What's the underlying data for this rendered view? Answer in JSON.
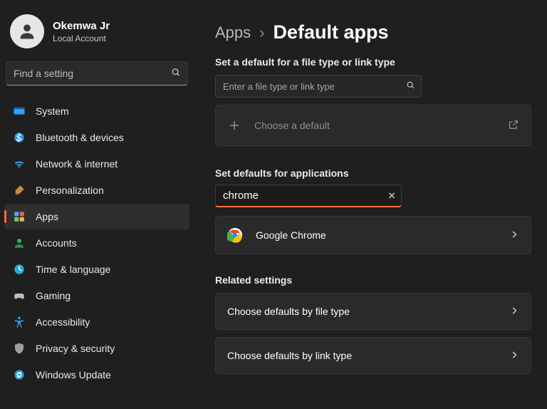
{
  "profile": {
    "name": "Okemwa Jr",
    "subtitle": "Local Account"
  },
  "sidebar_search_placeholder": "Find a setting",
  "nav": {
    "items": [
      {
        "id": "system",
        "label": "System"
      },
      {
        "id": "bluetooth",
        "label": "Bluetooth & devices"
      },
      {
        "id": "network",
        "label": "Network & internet"
      },
      {
        "id": "personalization",
        "label": "Personalization"
      },
      {
        "id": "apps",
        "label": "Apps"
      },
      {
        "id": "accounts",
        "label": "Accounts"
      },
      {
        "id": "time",
        "label": "Time & language"
      },
      {
        "id": "gaming",
        "label": "Gaming"
      },
      {
        "id": "accessibility",
        "label": "Accessibility"
      },
      {
        "id": "privacy",
        "label": "Privacy & security"
      },
      {
        "id": "update",
        "label": "Windows Update"
      }
    ],
    "active": "apps"
  },
  "breadcrumb": {
    "parent": "Apps",
    "current": "Default apps"
  },
  "sections": {
    "filetype_heading": "Set a default for a file type or link type",
    "filetype_placeholder": "Enter a file type or link type",
    "choose_default_label": "Choose a default",
    "apps_heading": "Set defaults for applications",
    "app_search_value": "chrome",
    "results": [
      {
        "name": "Google Chrome"
      }
    ],
    "related_heading": "Related settings",
    "related_rows": [
      {
        "label": "Choose defaults by file type"
      },
      {
        "label": "Choose defaults by link type"
      }
    ]
  }
}
